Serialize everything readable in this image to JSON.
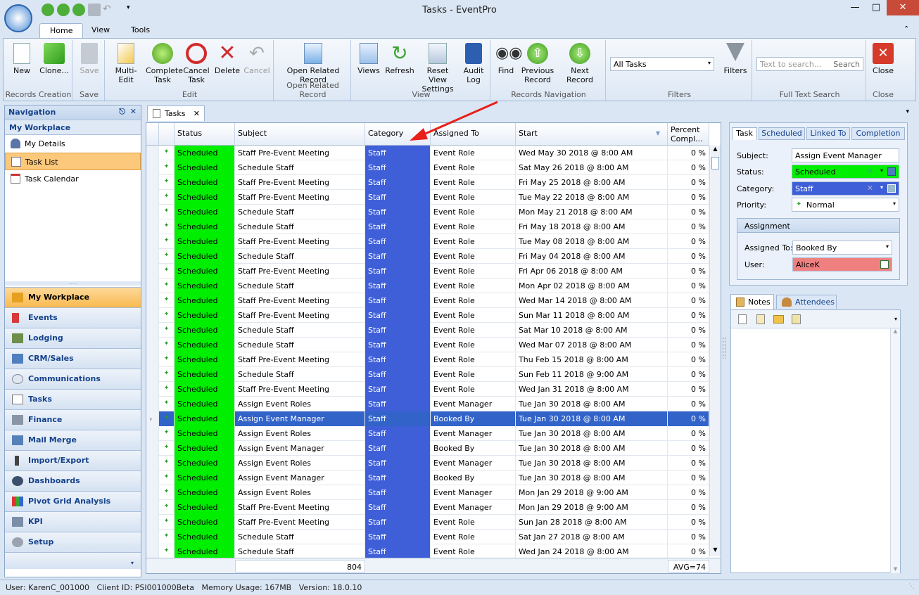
{
  "window": {
    "title": "Tasks - EventPro"
  },
  "ribbon_tabs": [
    "Home",
    "View",
    "Tools"
  ],
  "ribbon": {
    "records_creation": {
      "label": "Records Creation",
      "new": "New",
      "clone": "Clone..."
    },
    "save": {
      "label": "Save",
      "save": "Save"
    },
    "edit": {
      "label": "Edit",
      "multi_edit": "Multi-Edit",
      "complete_task": "Complete Task",
      "cancel_task": "Cancel Task",
      "delete": "Delete",
      "cancel": "Cancel"
    },
    "open_related": {
      "label": "Open Related Record",
      "button": "Open Related Record"
    },
    "view": {
      "label": "View",
      "views": "Views",
      "refresh": "Refresh",
      "reset_view": "Reset View Settings",
      "audit_log": "Audit Log"
    },
    "records_nav": {
      "label": "Records Navigation",
      "find": "Find",
      "previous": "Previous Record",
      "next": "Next Record"
    },
    "filters": {
      "label": "Filters",
      "selected": "All Tasks",
      "button": "Filters"
    },
    "fts": {
      "label": "Full Text Search",
      "placeholder": "Text to search...",
      "search": "Search"
    },
    "close": {
      "label": "Close",
      "button": "Close"
    }
  },
  "navigation": {
    "header": "Navigation",
    "sub_header": "My Workplace",
    "items": [
      "My Details",
      "Task List",
      "Task Calendar"
    ],
    "sections": [
      "My Workplace",
      "Events",
      "Lodging",
      "CRM/Sales",
      "Communications",
      "Tasks",
      "Finance",
      "Mail Merge",
      "Import/Export",
      "Dashboards",
      "Pivot Grid Analysis",
      "KPI",
      "Setup"
    ]
  },
  "doc_tab": "Tasks",
  "grid": {
    "columns": [
      "Status",
      "Subject",
      "Category",
      "Assigned To",
      "Start",
      "Percent Compl..."
    ],
    "rows": [
      [
        "Scheduled",
        "Staff Pre-Event Meeting",
        "Staff",
        "Event Role",
        "Wed May 30 2018 @ 8:00 AM",
        "0 %"
      ],
      [
        "Scheduled",
        "Schedule Staff",
        "Staff",
        "Event Role",
        "Sat May 26 2018 @ 8:00 AM",
        "0 %"
      ],
      [
        "Scheduled",
        "Staff Pre-Event Meeting",
        "Staff",
        "Event Role",
        "Fri May 25 2018 @ 8:00 AM",
        "0 %"
      ],
      [
        "Scheduled",
        "Staff Pre-Event Meeting",
        "Staff",
        "Event Role",
        "Tue May 22 2018 @ 8:00 AM",
        "0 %"
      ],
      [
        "Scheduled",
        "Schedule Staff",
        "Staff",
        "Event Role",
        "Mon May 21 2018 @ 8:00 AM",
        "0 %"
      ],
      [
        "Scheduled",
        "Schedule Staff",
        "Staff",
        "Event Role",
        "Fri May 18 2018 @ 8:00 AM",
        "0 %"
      ],
      [
        "Scheduled",
        "Staff Pre-Event Meeting",
        "Staff",
        "Event Role",
        "Tue May 08 2018 @ 8:00 AM",
        "0 %"
      ],
      [
        "Scheduled",
        "Schedule Staff",
        "Staff",
        "Event Role",
        "Fri May 04 2018 @ 8:00 AM",
        "0 %"
      ],
      [
        "Scheduled",
        "Staff Pre-Event Meeting",
        "Staff",
        "Event Role",
        "Fri Apr 06 2018 @ 8:00 AM",
        "0 %"
      ],
      [
        "Scheduled",
        "Schedule Staff",
        "Staff",
        "Event Role",
        "Mon Apr 02 2018 @ 8:00 AM",
        "0 %"
      ],
      [
        "Scheduled",
        "Staff Pre-Event Meeting",
        "Staff",
        "Event Role",
        "Wed Mar 14 2018 @ 8:00 AM",
        "0 %"
      ],
      [
        "Scheduled",
        "Staff Pre-Event Meeting",
        "Staff",
        "Event Role",
        "Sun Mar 11 2018 @ 8:00 AM",
        "0 %"
      ],
      [
        "Scheduled",
        "Schedule Staff",
        "Staff",
        "Event Role",
        "Sat Mar 10 2018 @ 8:00 AM",
        "0 %"
      ],
      [
        "Scheduled",
        "Schedule Staff",
        "Staff",
        "Event Role",
        "Wed Mar 07 2018 @ 8:00 AM",
        "0 %"
      ],
      [
        "Scheduled",
        "Staff Pre-Event Meeting",
        "Staff",
        "Event Role",
        "Thu Feb 15 2018 @ 8:00 AM",
        "0 %"
      ],
      [
        "Scheduled",
        "Schedule Staff",
        "Staff",
        "Event Role",
        "Sun Feb 11 2018 @ 9:00 AM",
        "0 %"
      ],
      [
        "Scheduled",
        "Staff Pre-Event Meeting",
        "Staff",
        "Event Role",
        "Wed Jan 31 2018 @ 8:00 AM",
        "0 %"
      ],
      [
        "Scheduled",
        "Assign Event Roles",
        "Staff",
        "Event Manager",
        "Tue Jan 30 2018 @ 8:00 AM",
        "0 %"
      ],
      [
        "Scheduled",
        "Assign Event Manager",
        "Staff",
        "Booked By",
        "Tue Jan 30 2018 @ 8:00 AM",
        "0 %"
      ],
      [
        "Scheduled",
        "Assign Event Roles",
        "Staff",
        "Event Manager",
        "Tue Jan 30 2018 @ 8:00 AM",
        "0 %"
      ],
      [
        "Scheduled",
        "Assign Event Manager",
        "Staff",
        "Booked By",
        "Tue Jan 30 2018 @ 8:00 AM",
        "0 %"
      ],
      [
        "Scheduled",
        "Assign Event Roles",
        "Staff",
        "Event Manager",
        "Tue Jan 30 2018 @ 8:00 AM",
        "0 %"
      ],
      [
        "Scheduled",
        "Assign Event Manager",
        "Staff",
        "Booked By",
        "Tue Jan 30 2018 @ 8:00 AM",
        "0 %"
      ],
      [
        "Scheduled",
        "Assign Event Roles",
        "Staff",
        "Event Manager",
        "Mon Jan 29 2018 @ 9:00 AM",
        "0 %"
      ],
      [
        "Scheduled",
        "Staff Pre-Event Meeting",
        "Staff",
        "Event Manager",
        "Mon Jan 29 2018 @ 9:00 AM",
        "0 %"
      ],
      [
        "Scheduled",
        "Staff Pre-Event Meeting",
        "Staff",
        "Event Role",
        "Sun Jan 28 2018 @ 8:00 AM",
        "0 %"
      ],
      [
        "Scheduled",
        "Schedule Staff",
        "Staff",
        "Event Role",
        "Sat Jan 27 2018 @ 8:00 AM",
        "0 %"
      ],
      [
        "Scheduled",
        "Schedule Staff",
        "Staff",
        "Event Role",
        "Wed Jan 24 2018 @ 8:00 AM",
        "0 %"
      ]
    ],
    "selected_row": 18,
    "footer_count": "804",
    "footer_avg": "AVG=74"
  },
  "detail": {
    "tabs": [
      "Task",
      "Scheduled",
      "Linked To",
      "Completion"
    ],
    "subject_label": "Subject:",
    "subject": "Assign Event Manager",
    "status_label": "Status:",
    "status": "Scheduled",
    "category_label": "Category:",
    "category": "Staff",
    "priority_label": "Priority:",
    "priority": "Normal",
    "assignment_header": "Assignment",
    "assigned_to_label": "Assigned To:",
    "assigned_to": "Booked By",
    "user_label": "User:",
    "user": "AliceK"
  },
  "notes_tabs": [
    "Notes",
    "Attendees"
  ],
  "status_bar": "User: KarenC_001000   Client ID: PSI001000Beta   Memory Usage: 167MB   Version: 18.0.10",
  "colors": {
    "status_green": "#00ee00",
    "category_blue": "#3f5fd8",
    "selection": "#3263c8",
    "user_red": "#f08080",
    "nav_selected": "#fbc87c"
  }
}
